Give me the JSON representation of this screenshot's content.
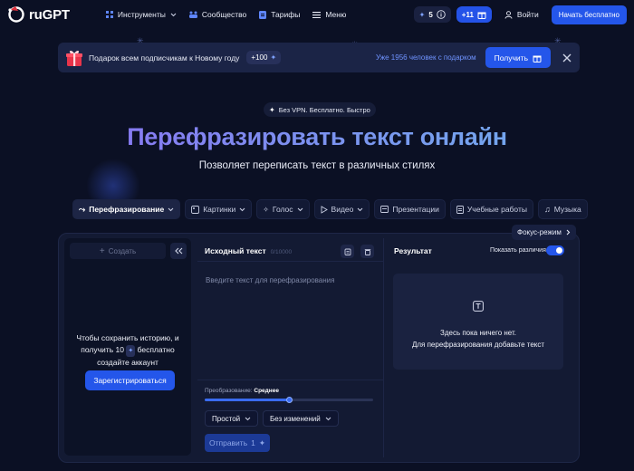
{
  "brand": {
    "name": "ruGPT"
  },
  "nav": {
    "links": [
      {
        "label": "Инструменты",
        "icon": "grid-icon"
      },
      {
        "label": "Сообщество",
        "icon": "community-icon"
      },
      {
        "label": "Тарифы",
        "icon": "tariff-icon"
      },
      {
        "label": "Меню",
        "icon": "menu-icon"
      }
    ],
    "credits": "5",
    "bonus": "+11",
    "login": "Войти",
    "start_free": "Начать бесплатно"
  },
  "banner": {
    "text": "Подарок всем подписчикам к Новому году",
    "badge": "+100",
    "count_text": "Уже 1956 человек с подарком",
    "button": "Получить"
  },
  "hero": {
    "tagline": "Без VPN. Бесплатно. Быстро",
    "title": "Перефразировать текст онлайн",
    "subtitle": "Позволяет переписать текст в различных стилях"
  },
  "tabs": [
    {
      "label": "Перефразирование",
      "icon": "paraphrase-icon",
      "active": true,
      "dropdown": true
    },
    {
      "label": "Картинки",
      "icon": "image-icon",
      "dropdown": true
    },
    {
      "label": "Голос",
      "icon": "voice-icon",
      "dropdown": true
    },
    {
      "label": "Видео",
      "icon": "video-icon",
      "dropdown": true
    },
    {
      "label": "Презентации",
      "icon": "presentation-icon",
      "dropdown": false
    },
    {
      "label": "Учебные работы",
      "icon": "study-icon",
      "dropdown": false
    },
    {
      "label": "Музыка",
      "icon": "music-icon",
      "dropdown": false
    }
  ],
  "focus_mode": "Фокус-режим",
  "sidebar": {
    "create": "Создать",
    "history_line1": "Чтобы сохранить историю, и",
    "history_line2_a": "получить 10",
    "history_line2_b": "бесплатно",
    "history_line3": "создайте аккаунт",
    "register": "Зарегистрироваться"
  },
  "source": {
    "title": "Исходный текст",
    "count": "0/10000",
    "placeholder": "Введите текст для перефразирования",
    "transform_label": "Преобразование:",
    "transform_value": "Среднее",
    "transform_level": 0.5,
    "style_select": "Простой",
    "change_select": "Без изменений",
    "send": "Отправить",
    "send_cost": "1"
  },
  "result": {
    "title": "Результат",
    "show_diff": "Показать различия",
    "show_diff_on": true,
    "empty_line1": "Здесь пока ничего нет.",
    "empty_line2": "Для перефразирования добавьте текст"
  },
  "colors": {
    "background": "#0b1024",
    "accent": "#2456ea",
    "panel": "#131a33"
  }
}
